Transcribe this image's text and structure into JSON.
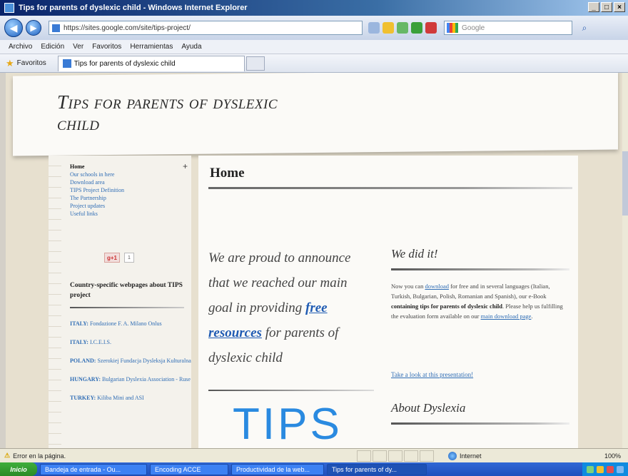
{
  "window": {
    "title": "Tips for parents of dyslexic child - Windows Internet Explorer",
    "controls": [
      "_",
      "□",
      "×"
    ]
  },
  "toolbar": {
    "address": "https://sites.google.com/site/tips-project/",
    "search_placeholder": "Google"
  },
  "menu": [
    "Archivo",
    "Edición",
    "Ver",
    "Favoritos",
    "Herramientas",
    "Ayuda"
  ],
  "favorites": {
    "label": "Favoritos",
    "tab_title": "Tips for parents of dyslexic child"
  },
  "page": {
    "site_title": "Tips for parents of dyslexic child",
    "nav": {
      "home": "Home",
      "items": [
        "Our schools in here",
        "Download area",
        "TIPS Project Definition",
        "The Partnership",
        "Project updates",
        "Useful links"
      ]
    },
    "gplus": {
      "label": "g+1",
      "count": "1"
    },
    "country_heading": "Country-specific webpages about TIPS project",
    "countries": [
      {
        "country": "ITALY:",
        "org": "Fondazione F. A. Milano Onlus"
      },
      {
        "country": "ITALY:",
        "org": "I.C.E.I.S."
      },
      {
        "country": "POLAND:",
        "org": "Szerokiej Fundacja Dysleksja Kulturalna"
      },
      {
        "country": "HUNGARY:",
        "org": "Bulgarian Dyslexia Association - Ruse"
      },
      {
        "country": "TURKEY:",
        "org": "Kiliba Mini and ASI"
      }
    ],
    "main": {
      "title": "Home",
      "proud_before": "We are proud to announce that we reached our main goal in providing ",
      "proud_link": "free resources",
      "proud_after": " for parents of dyslexic child",
      "logo": "TIPS",
      "did_it_head": "We did it!",
      "did_it_1": "Now you can ",
      "did_it_link1": "download",
      "did_it_2": " for free and in several languages (Italian, Turkish, Bulgarian, Polish, Romanian and Spanish), our e-Book ",
      "did_it_bold": "containing tips for parents of dyslexic child",
      "did_it_3": ". Please help us fulfilling the evaluation form available on our ",
      "did_it_link2": "main download page",
      "did_it_4": ".",
      "presentation_link": "Take a look at this presentation!",
      "about_head": "About Dyslexia"
    }
  },
  "status": {
    "left": "Error en la página.",
    "zone": "Internet",
    "zoom": "100%"
  },
  "taskbar": {
    "start": "Inicio",
    "tasks": [
      "Bandeja de entrada - Ou...",
      "Encoding ACCE",
      "Productividad de la web...",
      "Tips for parents of dy..."
    ]
  }
}
